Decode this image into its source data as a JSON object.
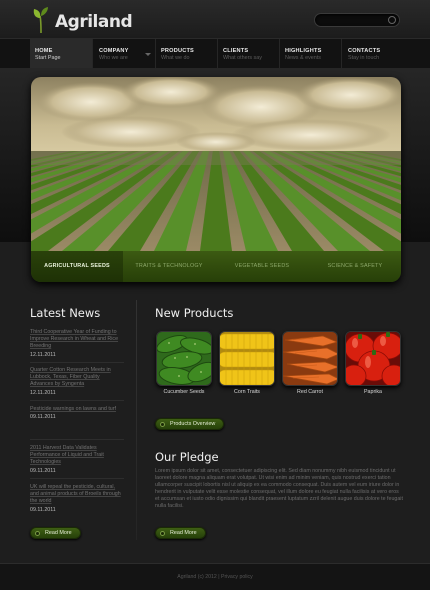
{
  "brand": {
    "name": "Agriland"
  },
  "search": {
    "placeholder": ""
  },
  "nav": [
    {
      "title": "HOME",
      "subtitle": "Start Page",
      "active": true
    },
    {
      "title": "COMPANY",
      "subtitle": "Who we are",
      "active": false
    },
    {
      "title": "PRODUCTS",
      "subtitle": "What we do",
      "active": false
    },
    {
      "title": "CLIENTS",
      "subtitle": "What others say",
      "active": false
    },
    {
      "title": "HIGHLIGHTS",
      "subtitle": "News & events",
      "active": false
    },
    {
      "title": "CONTACTS",
      "subtitle": "Stay in touch",
      "active": false
    }
  ],
  "slider": {
    "tabs": [
      {
        "label": "AGRICULTURAL SEEDS",
        "active": true
      },
      {
        "label": "TRAITS & TECHNOLOGY",
        "active": false
      },
      {
        "label": "VEGETABLE SEEDS",
        "active": false
      },
      {
        "label": "SCIENCE & SAFETY",
        "active": false
      }
    ]
  },
  "news": {
    "title": "Latest News",
    "items": [
      {
        "text": "Third Cooperative Year of Funding to Improve Research in Wheat and Rice Breeding",
        "date": "12.11.2011"
      },
      {
        "text": "Quarter Cotton Research Meets in Lubbock, Texas, Fiber Quality Advances by Syngenta",
        "date": "12.11.2011"
      },
      {
        "text": "Pesticide warnings on lawns and turf",
        "date": "09.11.2011"
      },
      {
        "text": "2011 Harvest Data Validates Performance of Liquid and Trait Technologies",
        "date": "09.11.2011"
      },
      {
        "text": "UK will repeal the pesticide, cultural, and animal products of Broeils through the world",
        "date": "09.11.2011"
      }
    ],
    "read_more": "Read More"
  },
  "products": {
    "title": "New Products",
    "items": [
      {
        "name": "Cucumber Seeds",
        "icon": "cucumber-image"
      },
      {
        "name": "Corn Traits",
        "icon": "corn-image"
      },
      {
        "name": "Red Carrot",
        "icon": "carrot-image"
      },
      {
        "name": "Paprika",
        "icon": "paprika-image"
      }
    ],
    "overview_label": "Products Overview"
  },
  "pledge": {
    "title": "Our Pledge",
    "text": "Lorem ipsum dolor sit amet, consectetuer adipiscing elit. Sed diam nonummy nibh euismod tincidunt ut laoreet dolore magna aliquam erat volutpat. Ut wisi enim ad minim veniam, quis nostrud exerci tation ullamcorper suscipit lobortis nisl ut aliquip ex ea commodo consequat. Duis autem vel eum iriure dolor in hendrerit in vulputate velit esse molestie consequat, vel illum dolore eu feugiat nulla facilisis at vero eros et accumsan et iusto odio dignissim qui blandit praesent luptatum zzril delenit augue duis dolore te feugait nulla facilisi.",
    "read_more": "Read More"
  },
  "footer": {
    "text": "Agriland (c) 2012  |  Privacy policy"
  },
  "colors": {
    "accent_green": "#3e5e14",
    "background": "#1e1e1e"
  }
}
